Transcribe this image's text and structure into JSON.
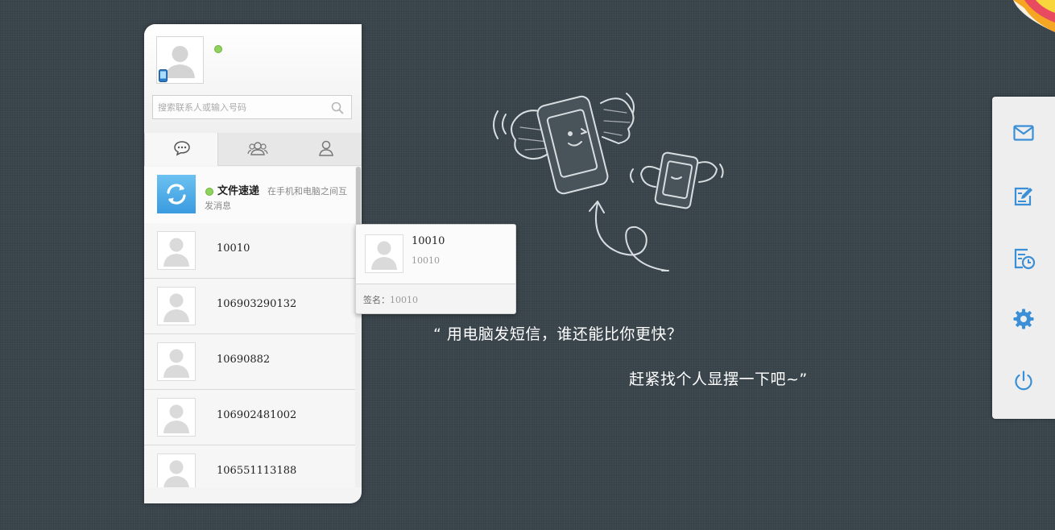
{
  "profile": {
    "status": "online"
  },
  "search": {
    "placeholder": "搜索联系人或输入号码"
  },
  "tabs": [
    {
      "icon": "chat-bubble-icon",
      "active": true
    },
    {
      "icon": "group-icon",
      "active": false
    },
    {
      "icon": "contact-icon",
      "active": false
    }
  ],
  "file_transfer": {
    "title": "文件速递",
    "description": "在手机和电脑之间互发消息",
    "icon": "sync-arrows-icon"
  },
  "contacts": [
    {
      "name": "10010"
    },
    {
      "name": "106903290132"
    },
    {
      "name": "10690882"
    },
    {
      "name": "106902481002"
    },
    {
      "name": "106551113188"
    }
  ],
  "hover_card": {
    "name": "10010",
    "number": "10010",
    "signature_label": "签名：",
    "signature_value": "10010"
  },
  "slogan": {
    "line1": "“ 用电脑发短信，谁还能比你更快？",
    "line2": "赶紧找个人显摆一下吧~”"
  },
  "toolbar": [
    {
      "icon": "mail-icon"
    },
    {
      "icon": "compose-icon"
    },
    {
      "icon": "scheduled-icon"
    },
    {
      "icon": "settings-gear-icon"
    },
    {
      "icon": "power-icon"
    }
  ],
  "colors": {
    "background": "#3a454c",
    "accent": "#3b8fd6",
    "online": "#8fd25c"
  }
}
